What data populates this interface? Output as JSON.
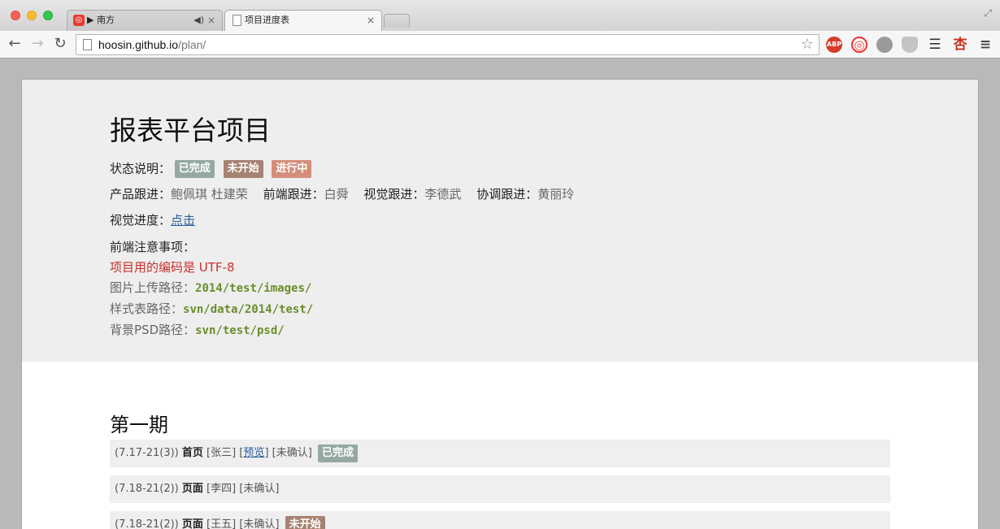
{
  "browser": {
    "tabs": [
      {
        "title": "▶ 南方",
        "active": false,
        "audio_icon": "speaker-icon"
      },
      {
        "title": "项目进度表",
        "active": true
      }
    ],
    "tab_close": "×",
    "url_host": "hoosin.github.io",
    "url_path": "/plan/",
    "extensions": [
      "ABP",
      "网",
      "",
      "",
      "☰",
      "杏",
      "≡"
    ]
  },
  "header": {
    "title": "报表平台项目",
    "status_label": "状态说明：",
    "status_badges": [
      {
        "label": "已完成",
        "color": "#95a9a4"
      },
      {
        "label": "未开始",
        "color": "#a68272"
      },
      {
        "label": "进行中",
        "color": "#d58e7b"
      }
    ],
    "owners": [
      {
        "label": "产品跟进：",
        "value": "鲍佩琪 杜建荣"
      },
      {
        "label": "前端跟进：",
        "value": "白舜"
      },
      {
        "label": "视觉跟进：",
        "value": "李德武"
      },
      {
        "label": "协调跟进：",
        "value": "黄丽玲"
      }
    ],
    "visual_progress_label": "视觉进度：",
    "visual_progress_link": "点击",
    "notes_title": "前端注意事项：",
    "encoding_note": "项目用的编码是 UTF-8",
    "paths": [
      {
        "label": "图片上传路径：",
        "value": "2014/test/images/"
      },
      {
        "label": "样式表路径：",
        "value": "svn/data/2014/test/"
      },
      {
        "label": "背景PSD路径：",
        "value": "svn/test/psd/"
      }
    ]
  },
  "phase": {
    "title": "第一期",
    "tasks": [
      {
        "date": "(7.17-21(3))",
        "page": "首页",
        "person": "[张三]",
        "preview": "预览",
        "confirm": "[未确认]",
        "status": "已完成"
      },
      {
        "date": "(7.18-21(2))",
        "page": "页面",
        "person": "[李四]",
        "confirm": "[未确认]",
        "status": ""
      },
      {
        "date": "(7.18-21(2))",
        "page": "页面",
        "person": "[王五]",
        "confirm": "[未确认]",
        "status": "未开始"
      }
    ]
  }
}
